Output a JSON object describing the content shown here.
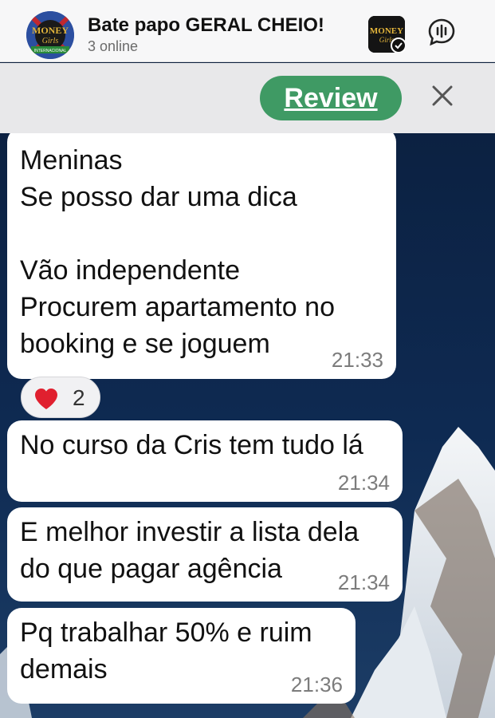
{
  "header": {
    "title": "Bate papo GERAL CHEIO!",
    "subtitle": "3 online",
    "avatar_logo_text": "MONEY Girls",
    "avatar_ribbon_text": "INTERNACIONAL"
  },
  "review_bar": {
    "review_label": "Review",
    "close_icon": "close-icon"
  },
  "messages": [
    {
      "text": "Meninas\nSe posso dar uma dica\n\nVão independente\nProcurem apartamento no\nbooking e se joguem",
      "time": "21:33"
    },
    {
      "text": "No curso da Cris tem tudo lá",
      "time": "21:34"
    },
    {
      "text": "E melhor investir a lista dela\ndo que pagar agência",
      "time": "21:34"
    },
    {
      "text": "Pq trabalhar 50% e ruim\ndemais",
      "time": "21:36"
    }
  ],
  "reaction": {
    "emoji": "heart",
    "count": "2"
  },
  "colors": {
    "review_button": "#3f9a64",
    "header_bg": "#f7f7f8",
    "review_bar_bg": "#e8e8ea",
    "bubble_bg": "#ffffff",
    "heart": "#e0202f"
  }
}
